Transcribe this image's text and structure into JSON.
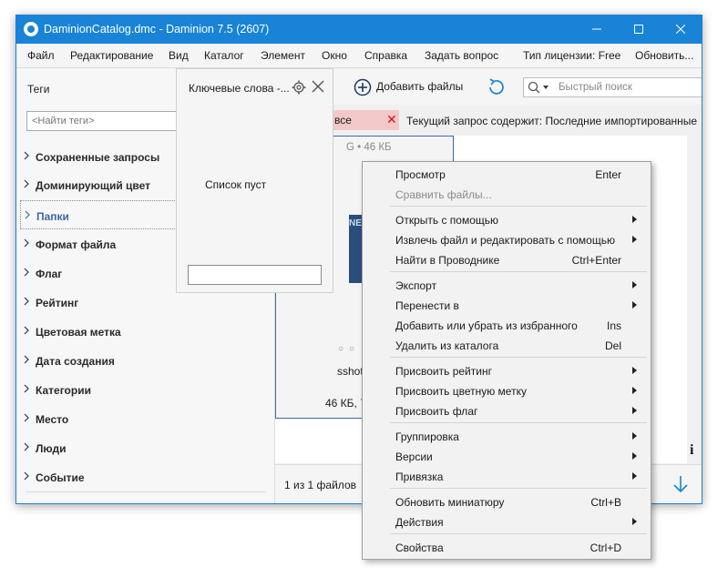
{
  "window": {
    "title": "DaminionCatalog.dmc - Daminion 7.5 (2607)"
  },
  "menu": {
    "items": [
      "Файл",
      "Редактирование",
      "Вид",
      "Каталог",
      "Элемент",
      "Окно",
      "Справка",
      "Задать вопрос"
    ],
    "license": "Тип лицензии: Free",
    "update": "Обновить..."
  },
  "tags_panel": {
    "title": "Теги",
    "search_placeholder": "<Найти теги>",
    "items": [
      "Сохраненные запросы",
      "Доминирующий цвет",
      "Папки",
      "Формат файла",
      "Флаг",
      "Рейтинг",
      "Цветовая метка",
      "Дата создания",
      "Категории",
      "Место",
      "Люди",
      "Событие"
    ],
    "selected": "Папки"
  },
  "keywords_panel": {
    "title": "Ключевые слова -...",
    "empty": "Список пуст"
  },
  "toolbar": {
    "add_files": "Добавить файлы",
    "quick_search": "Быстрый поиск"
  },
  "filter": {
    "chip_label": "все",
    "query": "Текущий запрос содержит: Последние импортированные"
  },
  "thumbnail": {
    "top_meta": "G • 46 КБ",
    "name": "sshot-",
    "size": "46 КБ, 7"
  },
  "status": {
    "count": "1 из 1 файлов"
  },
  "context_menu": {
    "groups": [
      [
        {
          "label": "Просмотр",
          "shortcut": "Enter",
          "submenu": false,
          "disabled": false
        },
        {
          "label": "Сравнить файлы...",
          "shortcut": "",
          "submenu": false,
          "disabled": true
        }
      ],
      [
        {
          "label": "Открыть с помощью",
          "shortcut": "",
          "submenu": true,
          "disabled": false
        },
        {
          "label": "Извлечь файл и редактировать с помощью",
          "shortcut": "",
          "submenu": true,
          "disabled": false
        },
        {
          "label": "Найти в Проводнике",
          "shortcut": "Ctrl+Enter",
          "submenu": false,
          "disabled": false
        }
      ],
      [
        {
          "label": "Экспорт",
          "shortcut": "",
          "submenu": true,
          "disabled": false
        },
        {
          "label": "Перенести в",
          "shortcut": "",
          "submenu": true,
          "disabled": false
        },
        {
          "label": "Добавить или убрать из избранного",
          "shortcut": "Ins",
          "submenu": false,
          "disabled": false
        },
        {
          "label": "Удалить из каталога",
          "shortcut": "Del",
          "submenu": false,
          "disabled": false
        }
      ],
      [
        {
          "label": "Присвоить рейтинг",
          "shortcut": "",
          "submenu": true,
          "disabled": false
        },
        {
          "label": "Присвоить цветную метку",
          "shortcut": "",
          "submenu": true,
          "disabled": false
        },
        {
          "label": "Присвоить флаг",
          "shortcut": "",
          "submenu": true,
          "disabled": false
        }
      ],
      [
        {
          "label": "Группировка",
          "shortcut": "",
          "submenu": true,
          "disabled": false
        },
        {
          "label": "Версии",
          "shortcut": "",
          "submenu": true,
          "disabled": false
        },
        {
          "label": "Привязка",
          "shortcut": "",
          "submenu": true,
          "disabled": false
        }
      ],
      [
        {
          "label": "Обновить миниатюру",
          "shortcut": "Ctrl+B",
          "submenu": false,
          "disabled": false
        },
        {
          "label": "Действия",
          "shortcut": "",
          "submenu": true,
          "disabled": false
        }
      ],
      [
        {
          "label": "Свойства",
          "shortcut": "Ctrl+D",
          "submenu": false,
          "disabled": false
        }
      ]
    ]
  },
  "colors": {
    "accent": "#1883d7",
    "selection_text": "#3e69a5",
    "chip": "#f2c8c8",
    "close_x": "#dd1111"
  },
  "icons": {
    "app": "app-logo-icon",
    "gear": "gear-icon",
    "close": "close-icon",
    "add": "plus-circle-icon",
    "refresh": "refresh-icon",
    "search": "search-icon",
    "chevron": "chevron-right-icon",
    "arrow_down": "arrow-down-icon",
    "info": "info-icon"
  }
}
